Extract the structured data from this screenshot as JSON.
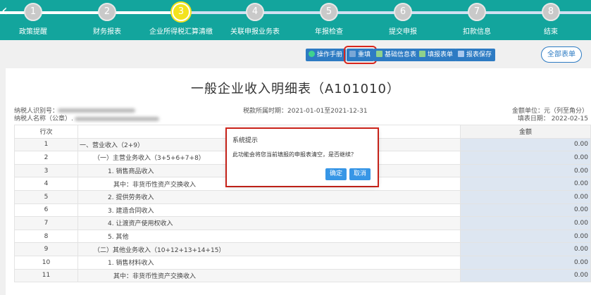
{
  "stepper": {
    "steps": [
      {
        "num": "1",
        "label": "政策提醒"
      },
      {
        "num": "2",
        "label": "财务报表"
      },
      {
        "num": "3",
        "label": "企业所得税汇算清缴"
      },
      {
        "num": "4",
        "label": "关联申报业务表"
      },
      {
        "num": "5",
        "label": "年报检查"
      },
      {
        "num": "6",
        "label": "提交申报"
      },
      {
        "num": "7",
        "label": "扣款信息"
      },
      {
        "num": "8",
        "label": "结束"
      }
    ],
    "active_index": 2
  },
  "toolbar": {
    "buttons": [
      {
        "label": "操作手册",
        "icon": "question-circle-icon"
      },
      {
        "label": "重填",
        "icon": "refresh-icon"
      },
      {
        "label": "基础信息表",
        "icon": "table-icon"
      },
      {
        "label": "填报表单",
        "icon": "table-icon"
      },
      {
        "label": "报表保存",
        "icon": "save-icon"
      }
    ],
    "all_forms": "全部表单"
  },
  "form": {
    "title": "一般企业收入明细表（A101010）",
    "taxpayer_id_label": "纳税人识别号：",
    "taxpayer_name_label": "纳税人名称（公章）.",
    "period": "税款所属时期：2021-01-01至2021-12-31",
    "unit": "金额单位：元（列至角分）",
    "fill_date": "填表日期： 2022-02-15",
    "col_index": "行次",
    "col_amount": "金额",
    "rows": [
      {
        "idx": "1",
        "name": "一、营业收入（2+9）",
        "indent": 0,
        "amount": "0.00"
      },
      {
        "idx": "2",
        "name": "（一）主营业务收入（3+5+6+7+8）",
        "indent": 1,
        "amount": "0.00"
      },
      {
        "idx": "3",
        "name": "1. 销售商品收入",
        "indent": 2,
        "amount": "0.00"
      },
      {
        "idx": "4",
        "name": "其中：非货币性资产交换收入",
        "indent": 3,
        "amount": "0.00"
      },
      {
        "idx": "5",
        "name": "2. 提供劳务收入",
        "indent": 2,
        "amount": "0.00"
      },
      {
        "idx": "6",
        "name": "3. 建造合同收入",
        "indent": 2,
        "amount": "0.00"
      },
      {
        "idx": "7",
        "name": "4. 让渡资产使用权收入",
        "indent": 2,
        "amount": "0.00"
      },
      {
        "idx": "8",
        "name": "5. 其他",
        "indent": 2,
        "amount": "0.00"
      },
      {
        "idx": "9",
        "name": "（二）其他业务收入（10+12+13+14+15）",
        "indent": 1,
        "amount": "0.00"
      },
      {
        "idx": "10",
        "name": "1. 销售材料收入",
        "indent": 2,
        "amount": "0.00"
      },
      {
        "idx": "11",
        "name": "其中：非货币性资产交换收入",
        "indent": 3,
        "amount": "0.00"
      }
    ]
  },
  "dialog": {
    "title": "系统提示",
    "message": "此功能会将您当前填报的申报表清空，是否继续？",
    "ok": "确定",
    "cancel": "取消"
  }
}
